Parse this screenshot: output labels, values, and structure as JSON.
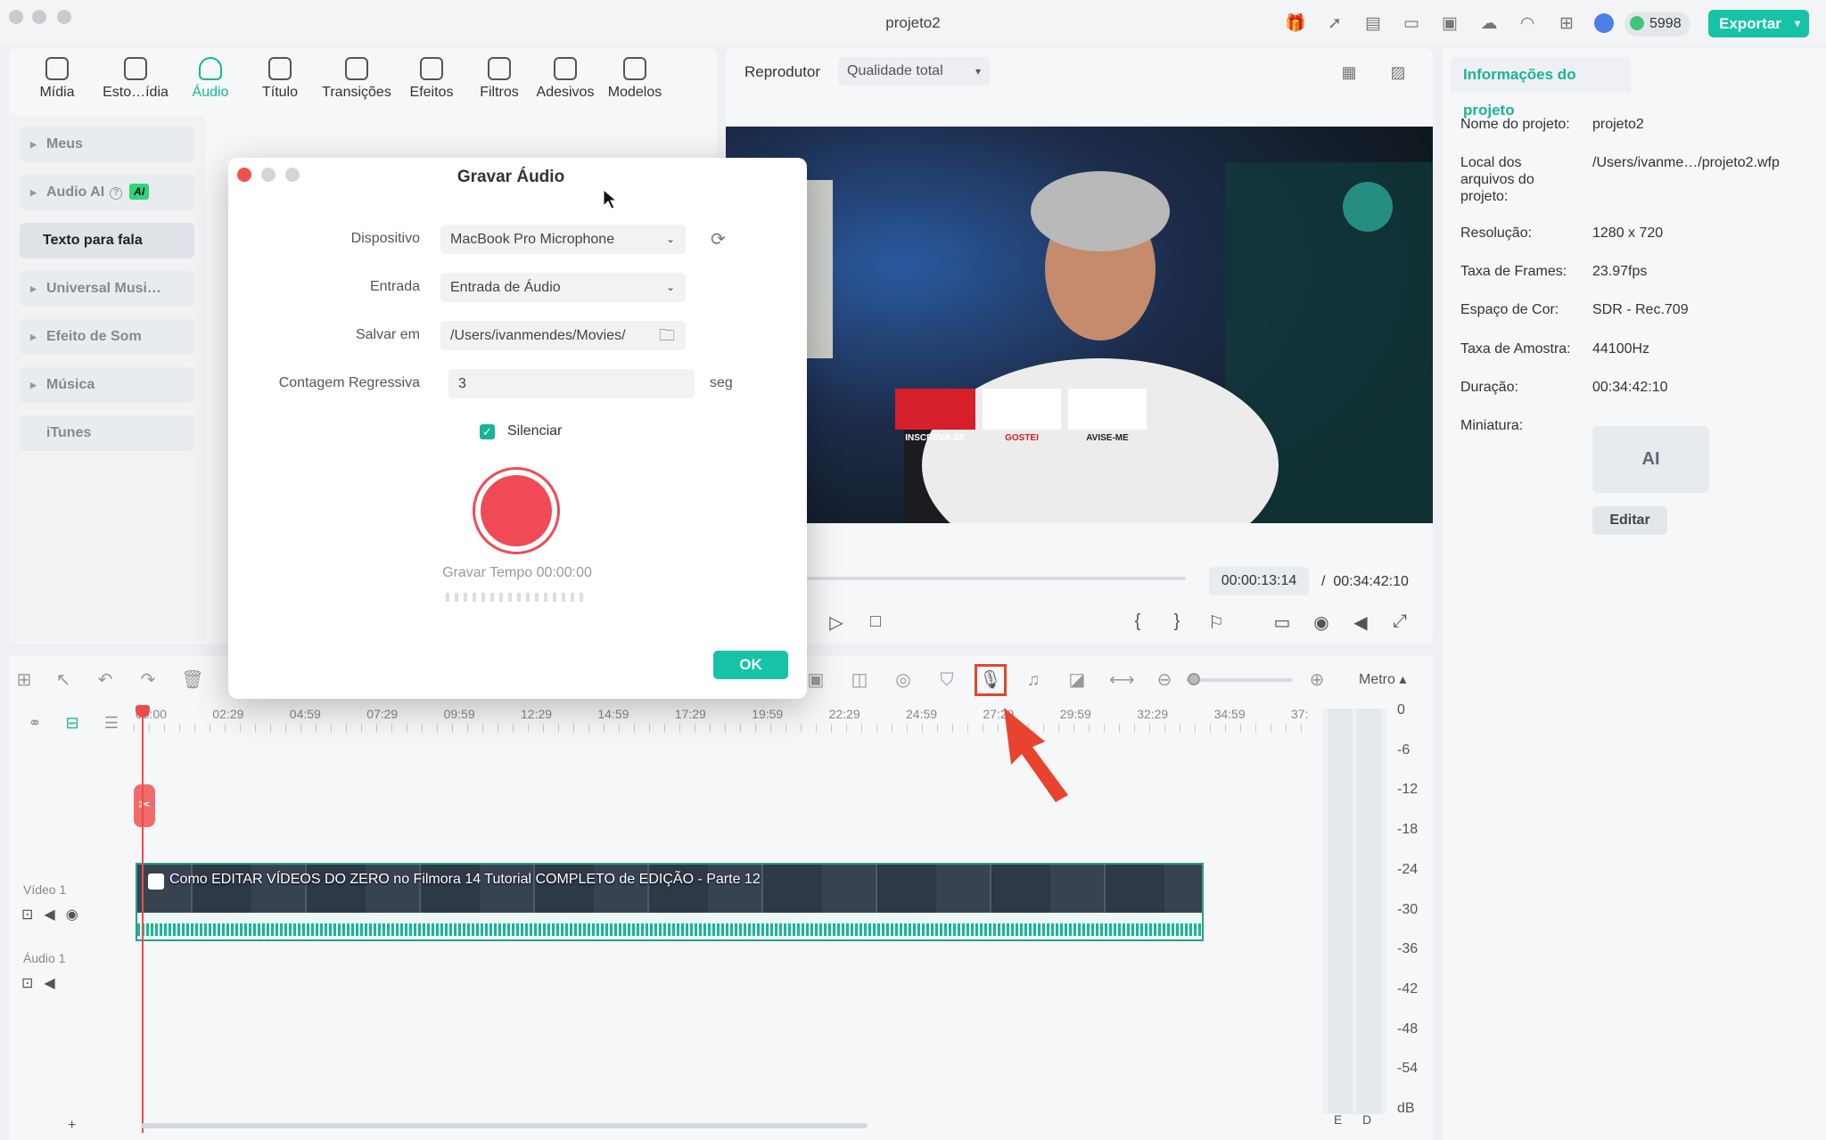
{
  "window": {
    "title": "projeto2"
  },
  "titlebar": {
    "credits": "5998",
    "export_label": "Exportar"
  },
  "media_tabs": [
    {
      "label": "Mídia",
      "icon": "media-icon"
    },
    {
      "label": "Esto…ídia",
      "icon": "stock-media-icon"
    },
    {
      "label": "Áudio",
      "icon": "music-note-icon",
      "active": true
    },
    {
      "label": "Título",
      "icon": "title-icon"
    },
    {
      "label": "Transições",
      "icon": "transitions-icon"
    },
    {
      "label": "Efeitos",
      "icon": "effects-icon"
    },
    {
      "label": "Filtros",
      "icon": "filters-icon"
    },
    {
      "label": "Adesivos",
      "icon": "stickers-icon"
    },
    {
      "label": "Modelos",
      "icon": "templates-icon"
    }
  ],
  "sidebar": {
    "items": [
      {
        "label": "Meus"
      },
      {
        "label": "Audio AI",
        "badge": "AI"
      },
      {
        "label": "Texto para fala",
        "active": true
      },
      {
        "label": "Universal Musi…"
      },
      {
        "label": "Efeito de Som"
      },
      {
        "label": "Música"
      },
      {
        "label": "iTunes"
      }
    ]
  },
  "player": {
    "label": "Reprodutor",
    "quality": "Qualidade total",
    "current_time": "00:00:13:14",
    "separator": "/",
    "total_time": "00:34:42:10",
    "video_overlay": [
      "INSCREVA-SE",
      "GOSTEI",
      "AVISE-ME"
    ]
  },
  "info": {
    "tab": "Informações do projeto",
    "rows": [
      {
        "key": "Nome do projeto:",
        "value": "projeto2"
      },
      {
        "key": "Local dos arquivos do projeto:",
        "value": "/Users/ivanme…/projeto2.wfp"
      },
      {
        "key": "Resolução:",
        "value": "1280 x 720"
      },
      {
        "key": "Taxa de Frames:",
        "value": "23.97fps"
      },
      {
        "key": "Espaço de Cor:",
        "value": "SDR - Rec.709"
      },
      {
        "key": "Taxa de Amostra:",
        "value": "44100Hz"
      },
      {
        "key": "Duração:",
        "value": "00:34:42:10"
      },
      {
        "key": "Miniatura:",
        "value": ""
      }
    ],
    "thumb_text": "AI",
    "edit_label": "Editar"
  },
  "dialog": {
    "title": "Gravar Áudio",
    "device_label": "Dispositivo",
    "device_value": "MacBook Pro Microphone",
    "input_label": "Entrada",
    "input_value": "Entrada de Áudio",
    "save_label": "Salvar em",
    "save_value": "/Users/ivanmendes/Movies/",
    "countdown_label": "Contagem Regressiva",
    "countdown_value": "3",
    "countdown_unit": "seg",
    "mute_label": "Silenciar",
    "mute_checked": true,
    "record_time": "Gravar Tempo 00:00:00",
    "ok_label": "OK"
  },
  "timeline": {
    "meter_label": "Metro",
    "ruler": [
      "00:00",
      "02:29",
      "04:59",
      "07:29",
      "09:59",
      "12:29",
      "14:59",
      "17:29",
      "19:59",
      "22:29",
      "24:59",
      "27:29",
      "29:59",
      "32:29",
      "34:59",
      "37:"
    ],
    "tracks": [
      {
        "label": "Vídeo 1"
      },
      {
        "label": "Áudio 1"
      }
    ],
    "clip_title": "Como EDITAR VÍDEOS DO ZERO no Filmora 14  Tutorial COMPLETO de EDIÇÃO - Parte 12",
    "meter_scale": [
      "0",
      "-6",
      "-12",
      "-18",
      "-24",
      "-30",
      "-36",
      "-42",
      "-48",
      "-54",
      "dB"
    ],
    "meter_channels": [
      "E",
      "D"
    ],
    "add_track": "+"
  },
  "colors": {
    "accent": "#16c3a6",
    "record": "#f04a56",
    "highlight": "#e0462f"
  }
}
